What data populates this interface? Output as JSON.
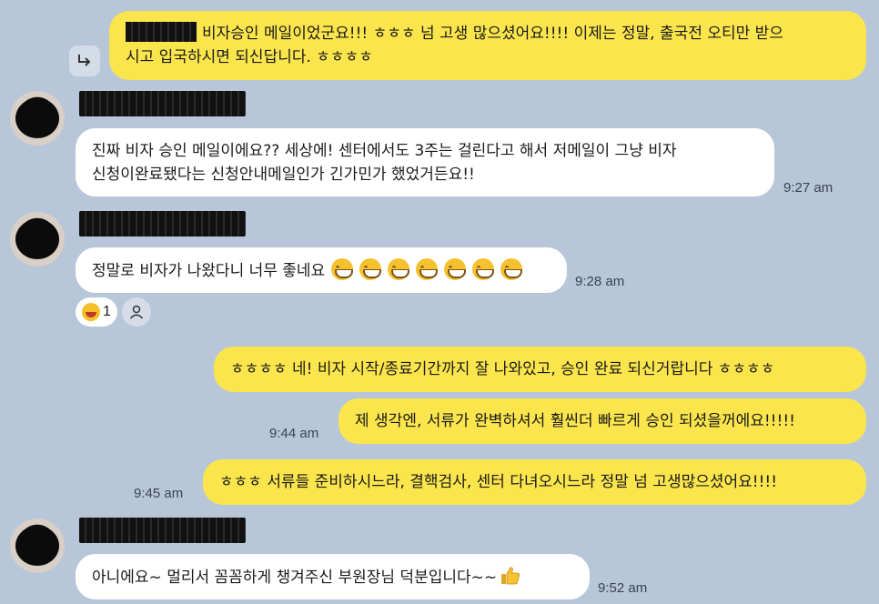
{
  "messages": [
    {
      "id": "m1",
      "side": "me",
      "lines": [
        "비자승인 메일이었군요!!! ㅎㅎㅎ 넘 고생 많으셨어요!!!! 이제는 정말, 출국전 오티만 받으",
        "시고 입국하시면 되신답니다. ㅎㅎㅎㅎ"
      ],
      "time": ""
    },
    {
      "id": "m2",
      "side": "them",
      "lines": [
        "진짜 비자 승인 메일이에요?? 세상에! 센터에서도 3주는 걸린다고 해서 저메일이 그냥 비자",
        "신청이완료됐다는 신청안내메일인가 긴가민가 했었거든요!!"
      ],
      "time": "9:27 am"
    },
    {
      "id": "m3",
      "side": "them",
      "lines": [
        "정말로 비자가 나왔다니 너무 좋네요"
      ],
      "emoji_count": 7,
      "time": "9:28 am",
      "reaction": {
        "emoji": "laughing-emoji",
        "count": "1"
      }
    },
    {
      "id": "m4",
      "side": "me",
      "lines": [
        "ㅎㅎㅎㅎ 네! 비자 시작/종료기간까지 잘 나와있고, 승인 완료 되신거랍니다 ㅎㅎㅎㅎ"
      ],
      "time": ""
    },
    {
      "id": "m5",
      "side": "me",
      "lines": [
        "제 생각엔, 서류가 완벽하셔서 훨씬더 빠르게 승인 되셨을꺼에요!!!!!"
      ],
      "time": "9:44 am"
    },
    {
      "id": "m6",
      "side": "me",
      "lines": [
        "ㅎㅎㅎ 서류들 준비하시느라, 결핵검사, 센터 다녀오시느라 정말 넘 고생많으셨어요!!!!"
      ],
      "time": "9:45 am"
    },
    {
      "id": "m7",
      "side": "them",
      "lines": [
        "아니에요~ 멀리서 꼼꼼하게 챙겨주신 부원장님 덕분입니다~~"
      ],
      "time": "9:52 am"
    }
  ],
  "colors": {
    "background": "#b7c7d9",
    "my_bubble": "#fbe54d",
    "their_bubble": "#ffffff"
  },
  "icons": {
    "reply": "reply-arrow-icon",
    "add_reaction": "person-icon",
    "grin": "grinning-face-emoji",
    "thumbs_up": "thumbs-up-emoji"
  }
}
